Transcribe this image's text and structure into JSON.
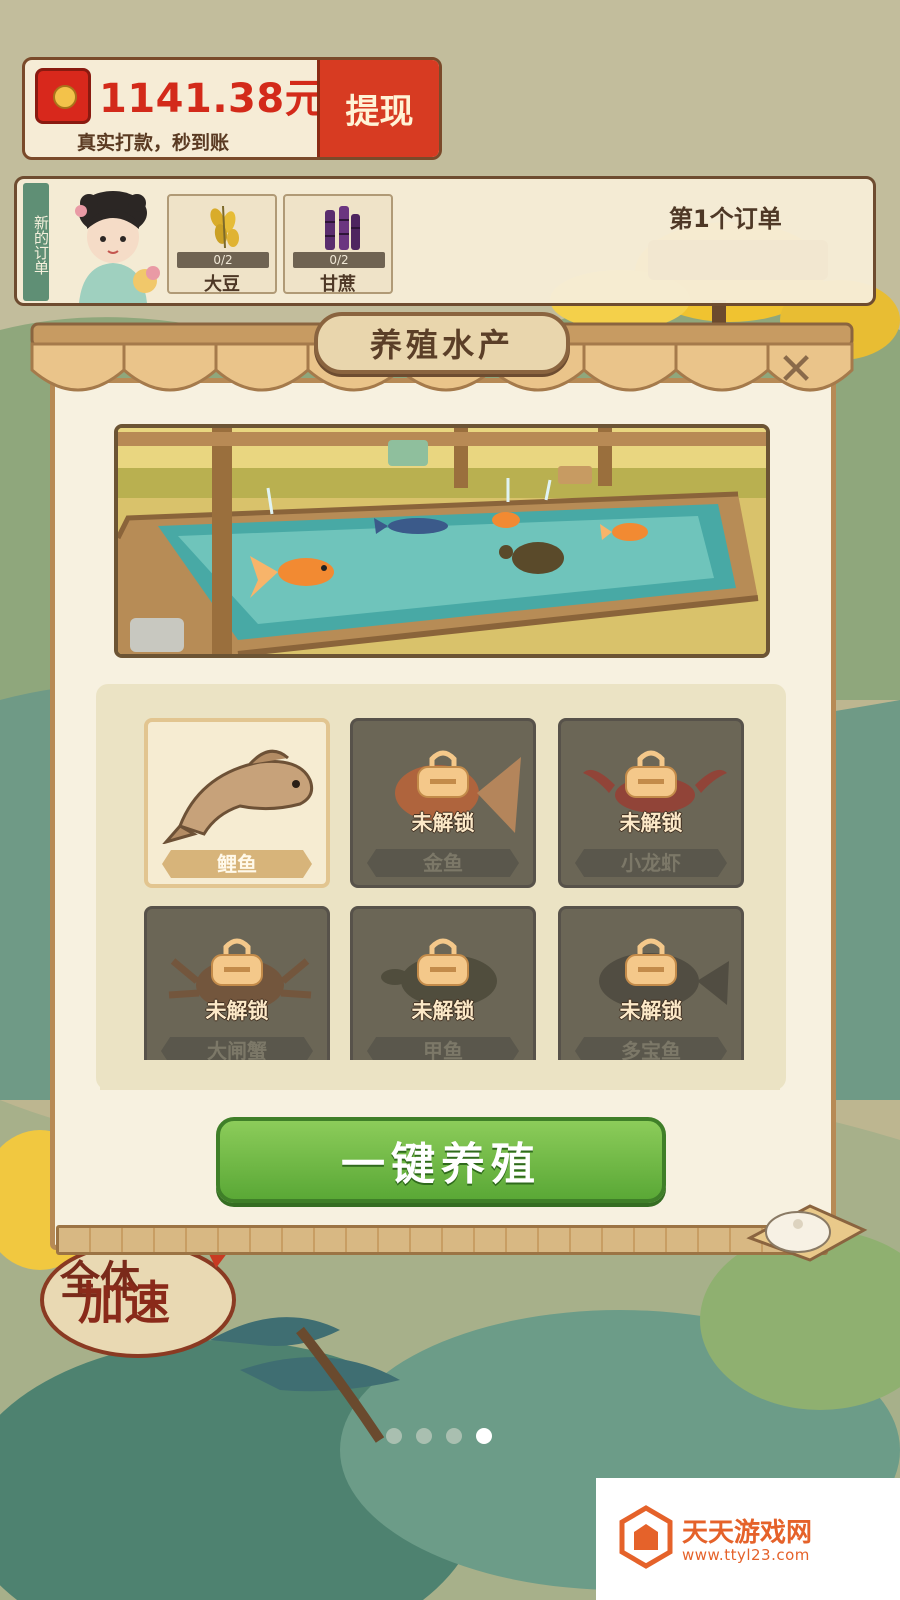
{
  "balance": {
    "amount": "1141.38元",
    "subtitle": "真实打款，秒到账",
    "withdraw_label": "提现"
  },
  "order": {
    "tag": "新的订单",
    "title": "第1个订单",
    "items": [
      {
        "name": "大豆",
        "progress": "0/2"
      },
      {
        "name": "甘蔗",
        "progress": "0/2"
      }
    ]
  },
  "panel": {
    "title": "养殖水产",
    "close_icon": "close-icon",
    "species": [
      {
        "name": "鲤鱼",
        "locked": false,
        "icon": "carp-icon"
      },
      {
        "name": "金鱼",
        "locked": true,
        "icon": "goldfish-icon"
      },
      {
        "name": "小龙虾",
        "locked": true,
        "icon": "crayfish-icon"
      },
      {
        "name": "大闸蟹",
        "locked": true,
        "icon": "crab-icon"
      },
      {
        "name": "甲鱼",
        "locked": true,
        "icon": "softshell-turtle-icon"
      },
      {
        "name": "多宝鱼",
        "locked": true,
        "icon": "turbot-icon"
      }
    ],
    "locked_label": "未解锁",
    "action_button": "一键养殖"
  },
  "accelerate": {
    "line1": "全体",
    "line2": "加速"
  },
  "pagination": {
    "total": 4,
    "current": 4
  },
  "watermark": {
    "title": "天天游戏网",
    "url": "www.ttyl23.com"
  },
  "colors": {
    "accent_red": "#d32a1a",
    "button_green": "#5aa836",
    "panel_wood": "#b78a55",
    "watermark_orange": "#e5622a"
  }
}
